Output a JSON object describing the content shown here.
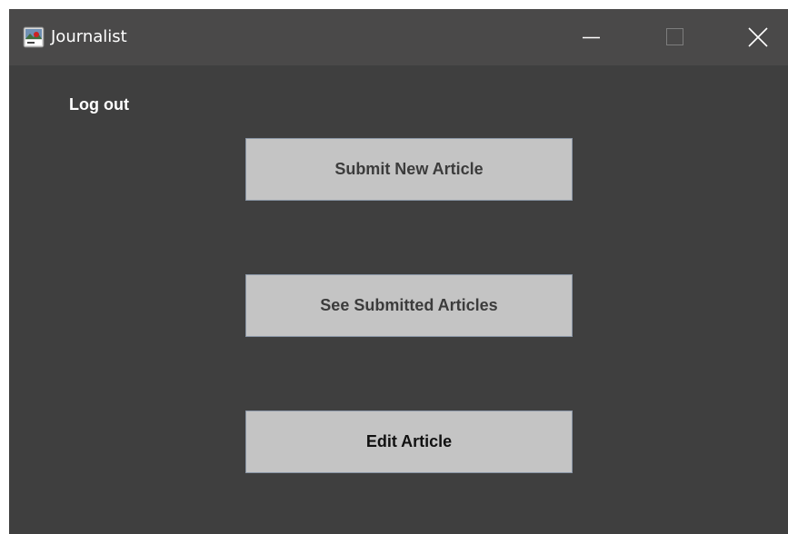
{
  "window": {
    "title": "Journalist",
    "controls": {
      "minimize_icon": "minimize-icon",
      "maximize_icon": "maximize-icon",
      "close_icon": "close-icon"
    }
  },
  "content": {
    "logout_label": "Log out",
    "buttons": {
      "submit_new_article": "Submit New Article",
      "see_submitted_articles": "See Submitted Articles",
      "edit_article": "Edit Article"
    }
  },
  "colors": {
    "window_background": "#3f3f3f",
    "titlebar_background": "#4a4949",
    "button_background": "#c4c4c4",
    "button_text": "#3c3c3c",
    "text_light": "#ffffff"
  }
}
